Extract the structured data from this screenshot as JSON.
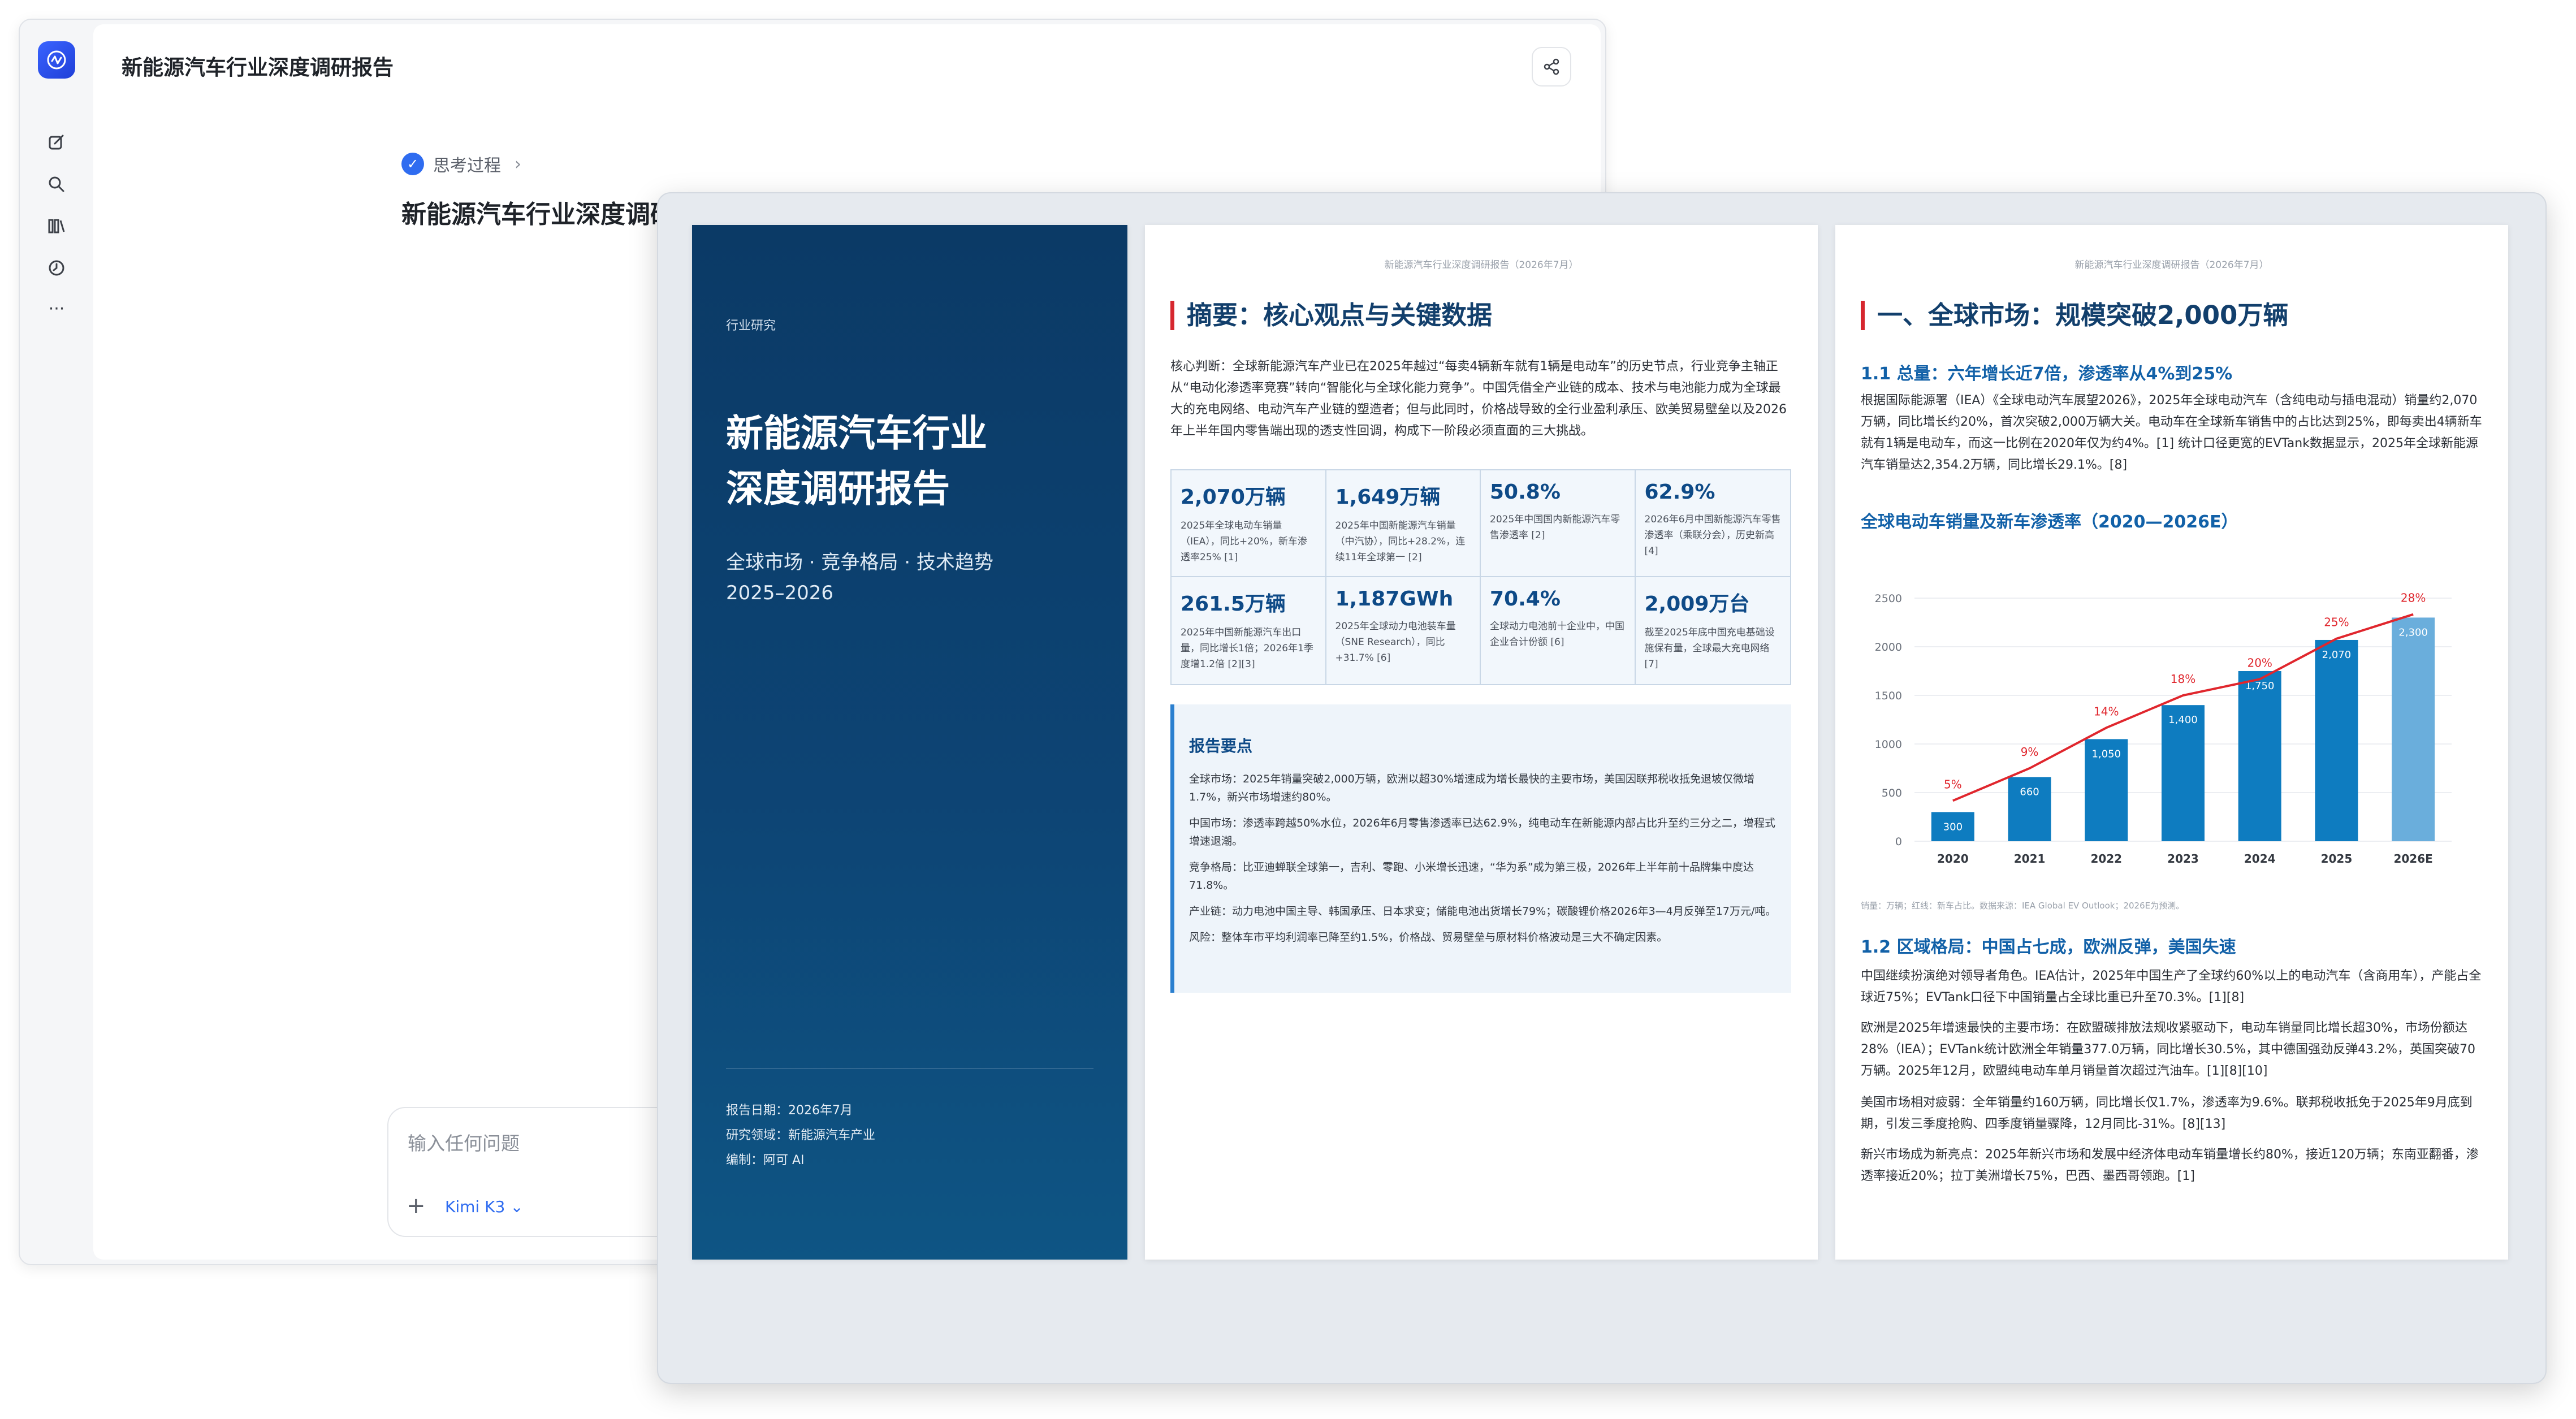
{
  "chat": {
    "title": "新能源汽车行业深度调研报告",
    "thinking_label": "思考过程",
    "answer_title": "新能源汽车行业深度调研报告",
    "input_placeholder": "输入任何问题",
    "model_label": "Kimi K3"
  },
  "cover": {
    "tag": "行业研究",
    "title_line1": "新能源汽车行业",
    "title_line2": "深度调研报告",
    "subtitle": "全球市场 · 竞争格局 · 技术趋势",
    "years": "2025–2026",
    "date": "报告日期：2026年7月",
    "field": "研究领域：新能源汽车产业",
    "editor": "编制：阿可 AI"
  },
  "page2": {
    "running_head": "新能源汽车行业深度调研报告（2026年7月）",
    "heading": "摘要：核心观点与关键数据",
    "intro": "核心判断：全球新能源汽车产业已在2025年越过“每卖4辆新车就有1辆是电动车”的历史节点，行业竞争主轴正从“电动化渗透率竞赛”转向“智能化与全球化能力竞争”。中国凭借全产业链的成本、技术与电池能力成为全球最大的充电网络、电动汽车产业链的塑造者；但与此同时，价格战导致的全行业盈利承压、欧美贸易壁垒以及2026年上半年国内零售端出现的透支性回调，构成下一阶段必须直面的三大挑战。",
    "kpis": [
      {
        "value": "2,070万辆",
        "desc": "2025年全球电动车销量（IEA），同比+20%，新车渗透率25% [1]"
      },
      {
        "value": "1,649万辆",
        "desc": "2025年中国新能源汽车销量（中汽协），同比+28.2%，连续11年全球第一 [2]"
      },
      {
        "value": "50.8%",
        "desc": "2025年中国国内新能源汽车零售渗透率 [2]"
      },
      {
        "value": "62.9%",
        "desc": "2026年6月中国新能源汽车零售渗透率（乘联分会），历史新高 [4]"
      },
      {
        "value": "261.5万辆",
        "desc": "2025年中国新能源汽车出口量，同比增长1倍；2026年1季度增1.2倍 [2][3]"
      },
      {
        "value": "1,187GWh",
        "desc": "2025年全球动力电池装车量（SNE Research），同比+31.7% [6]"
      },
      {
        "value": "70.4%",
        "desc": "全球动力电池前十企业中，中国企业合计份额 [6]"
      },
      {
        "value": "2,009万台",
        "desc": "截至2025年底中国充电基础设施保有量，全球最大充电网络 [7]"
      }
    ],
    "points_heading": "报告要点",
    "points": [
      "全球市场：2025年销量突破2,000万辆，欧洲以超30%增速成为增长最快的主要市场，美国因联邦税收抵免退坡仅微增1.7%，新兴市场增速约80%。",
      "中国市场：渗透率跨越50%水位，2026年6月零售渗透率已达62.9%，纯电动车在新能源内部占比升至约三分之二，增程式增速退潮。",
      "竞争格局：比亚迪蝉联全球第一，吉利、零跑、小米增长迅速，“华为系”成为第三极，2026年上半年前十品牌集中度达71.8%。",
      "产业链：动力电池中国主导、韩国承压、日本求变；储能电池出货增长79%；碳酸锂价格2026年3—4月反弹至17万元/吨。",
      "风险：整体车市平均利润率已降至约1.5%，价格战、贸易壁垒与原材料价格波动是三大不确定因素。"
    ]
  },
  "page3": {
    "running_head": "新能源汽车行业深度调研报告（2026年7月）",
    "heading": "一、全球市场：规模突破2,000万辆",
    "sub1": "1.1 总量：六年增长近7倍，渗透率从4%到25%",
    "para1": "根据国际能源署（IEA）《全球电动汽车展望2026》，2025年全球电动汽车（含纯电动与插电混动）销量约2,070万辆，同比增长约20%，首次突破2,000万辆大关。电动车在全球新车销售中的占比达到25%，即每卖出4辆新车就有1辆是电动车，而这一比例在2020年仅为约4%。[1] 统计口径更宽的EVTank数据显示，2025年全球新能源汽车销量达2,354.2万辆，同比增长29.1%。[8]",
    "chart_title": "全球电动车销量及新车渗透率（2020—2026E）",
    "chart_note": "销量：万辆；红线：新车占比。数据来源：IEA Global EV Outlook；2026E为预测。",
    "sub2": "1.2 区域格局：中国占七成，欧洲反弹，美国失速",
    "para2": "中国继续扮演绝对领导者角色。IEA估计，2025年中国生产了全球约60%以上的电动汽车（含商用车），产能占全球近75%；EVTank口径下中国销量占全球比重已升至70.3%。[1][8]",
    "para3": "欧洲是2025年增速最快的主要市场：在欧盟碳排放法规收紧驱动下，电动车销量同比增长超30%，市场份额达28%（IEA）；EVTank统计欧洲全年销量377.0万辆，同比增长30.5%，其中德国强劲反弹43.2%，英国突破70万辆。2025年12月，欧盟纯电动车单月销量首次超过汽油车。[1][8][10]",
    "para4": "美国市场相对疲弱：全年销量约160万辆，同比增长仅1.7%，渗透率为9.6%。联邦税收抵免于2025年9月底到期，引发三季度抢购、四季度销量骤降，12月同比-31%。[8][13]",
    "para5": "新兴市场成为新亮点：2025年新兴市场和发展中经济体电动车销量增长约80%，接近120万辆；东南亚翻番，渗透率接近20%；拉丁美洲增长75%，巴西、墨西哥领跑。[1]"
  },
  "chart_data": {
    "type": "bar",
    "title": "全球电动车销量及新车渗透率（2020—2026E）",
    "categories": [
      "2020",
      "2021",
      "2022",
      "2023",
      "2024",
      "2025",
      "2026E"
    ],
    "series": [
      {
        "values": [
          300,
          660,
          1050,
          1400,
          1750,
          2070,
          2300
        ],
        "labels": [
          "300",
          "660",
          "1,050",
          "1,400",
          "1,750",
          "2,070",
          "2,300"
        ],
        "color": "#0e7cc0",
        "forecast_color": "#6aaedc"
      },
      {
        "values": [
          5,
          9,
          14,
          18,
          20,
          25,
          28
        ],
        "labels": [
          "5%",
          "9%",
          "14%",
          "18%",
          "20%",
          "25%",
          "28%"
        ],
        "type": "line",
        "color": "#e0262d"
      }
    ],
    "y_ticks": [
      0,
      500,
      1000,
      1500,
      2000,
      2500
    ],
    "ylim": [
      0,
      2500
    ],
    "y2lim": [
      0,
      30
    ],
    "grid": true,
    "legend": "none"
  }
}
